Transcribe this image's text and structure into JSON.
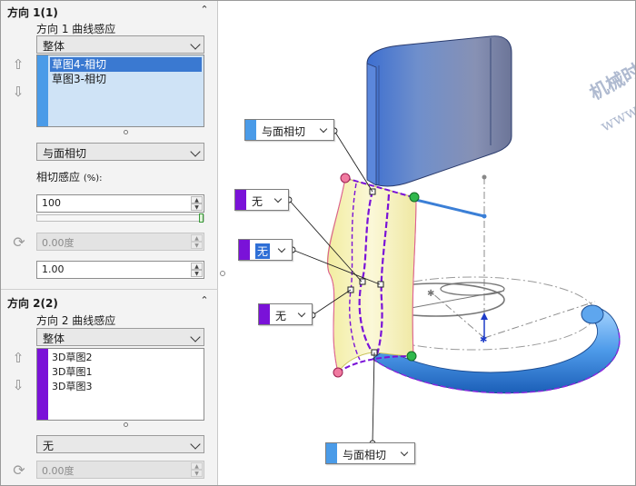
{
  "direction1": {
    "title": "方向 1(1)",
    "curve_influence_label": "方向 1 曲线感应",
    "curve_influence_value": "整体",
    "list_items": [
      "草图4-相切",
      "草图3-相切"
    ],
    "tangency_type": "与面相切",
    "tangent_influence_label": "相切感应",
    "tangent_influence_unit": "(%):",
    "tangent_influence_value": "100",
    "angle_value": "0.00度",
    "ratio_value": "1.00",
    "flag_color": "#4a9be8"
  },
  "direction2": {
    "title": "方向 2(2)",
    "curve_influence_label": "方向 2 曲线感应",
    "curve_influence_value": "整体",
    "list_items": [
      "3D草图2",
      "3D草图1",
      "3D草图3"
    ],
    "tangency_type": "无",
    "angle_value": "0.00度",
    "flag_color": "#7a12d8"
  },
  "callouts": {
    "top_face": "与面相切",
    "left_upper": "无",
    "left_middle": "无",
    "left_lower": "无",
    "bottom_face": "与面相切"
  },
  "watermark": {
    "line1": "机械时代网",
    "line2": "www.jxage.com"
  },
  "colors": {
    "accent_blue": "#4a9be8",
    "accent_purple": "#7a12d8",
    "list_selected": "#3a79d1",
    "surface_blue": "#3d82d8",
    "loft_yellow": "#f6f2b8"
  },
  "icons": {
    "collapse": "chevron-up-icon",
    "move_up": "arrow-up-icon",
    "move_down": "arrow-down-icon",
    "reset": "reverse-direction-icon"
  }
}
